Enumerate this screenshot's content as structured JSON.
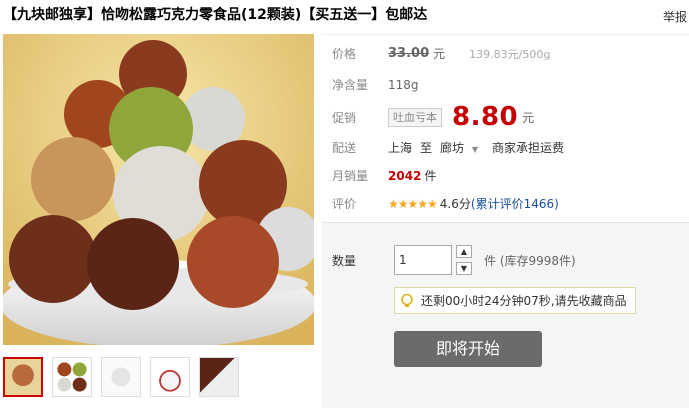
{
  "title": "【九块邮独享】恰吻松露巧克力零食品(12颗装)【买五送一】包邮达",
  "report_label": "举报",
  "product": {
    "price_label": "价格",
    "original_price": "33.00",
    "currency_unit": "元",
    "unit_price": "139.83元/500g",
    "net_weight_label": "净含量",
    "net_weight": "118g",
    "promo_label": "促销",
    "promo_tag": "吐血亏本",
    "promo_price": "8.80",
    "shipping_label": "配送",
    "ship_from": "上海",
    "ship_to_word": "至",
    "ship_dest": "廊坊",
    "shipping_note": "商家承担运费",
    "monthly_sales_label": "月销量",
    "monthly_sales": "2042",
    "sales_unit": "件",
    "rating_label": "评价",
    "rating_score": "4.6分",
    "rating_link": "(累计评价1466)"
  },
  "purchase": {
    "qty_label": "数量",
    "qty_value": "1",
    "stock_text": "件 (库存9998件)",
    "notice": "还剩00小时24分钟07秒,请先收藏商品",
    "buy_button": "即将开始"
  },
  "colors": {
    "price_red": "#c40000",
    "link_blue": "#1a4fa0",
    "star": "#f5a623",
    "buy_button": "#6b6b6b"
  },
  "rating_stars": 4.6
}
